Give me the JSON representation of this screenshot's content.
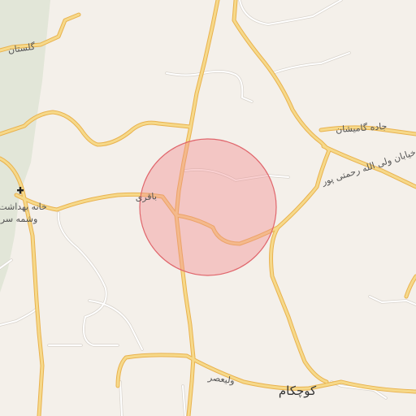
{
  "map": {
    "colors": {
      "land": "#f4f0ea",
      "green": "#e2e6d8",
      "road_fill": "#f6d98a",
      "road_casing": "#e9b24e",
      "minor_road": "#ffffff",
      "minor_road_casing": "#d8d3cc",
      "circle_fill": "#f08c90",
      "circle_stroke": "#e0666c"
    },
    "labels": {
      "golestan": "گلستان",
      "baghri": "باقری",
      "health_house_line1": "خانه بهداشت",
      "health_house_line2": "وشمه سرا",
      "gamishan_road": "جاده گامیشان",
      "vali_allah_road": "خیابان ولی الله رحمتی پور",
      "koochakam": "کوچکام",
      "valiasr": "ولیعصر"
    },
    "icons": {
      "health_house": "plus-icon"
    }
  }
}
